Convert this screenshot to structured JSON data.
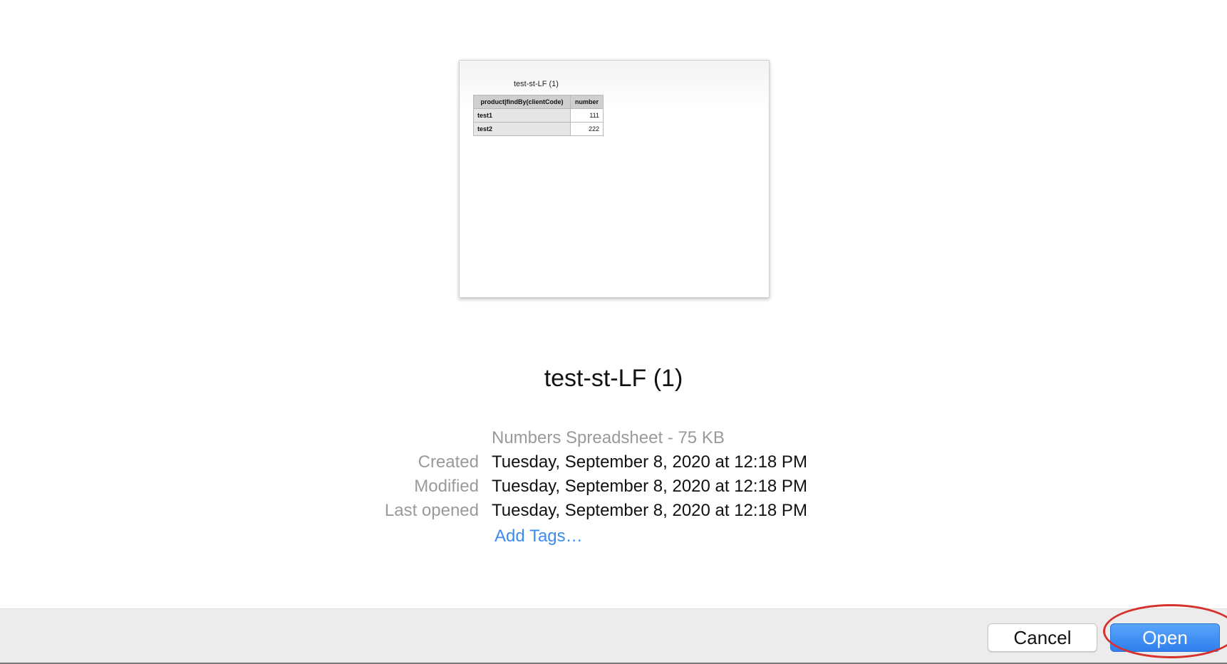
{
  "preview": {
    "sheet_title": "test-st-LF (1)",
    "table": {
      "headers": [
        "product|findBy(clientCode)",
        "number"
      ],
      "rows": [
        [
          "test1",
          "111"
        ],
        [
          "test2",
          "222"
        ]
      ]
    }
  },
  "file": {
    "name": "test-st-LF (1)",
    "kind_size": "Numbers Spreadsheet - 75 KB"
  },
  "info": [
    {
      "label": "Created",
      "value": "Tuesday, September 8, 2020 at 12:18 PM"
    },
    {
      "label": "Modified",
      "value": "Tuesday, September 8, 2020 at 12:18 PM"
    },
    {
      "label": "Last opened",
      "value": "Tuesday, September 8, 2020 at 12:18 PM"
    }
  ],
  "tags": {
    "add_label": "Add Tags…"
  },
  "buttons": {
    "cancel_label": "Cancel",
    "open_label": "Open"
  },
  "colors": {
    "accent": "#3b8cf0",
    "open_button": "#3a88f4",
    "annotation": "#d6312d",
    "secondary_text": "#9a9a9a"
  }
}
